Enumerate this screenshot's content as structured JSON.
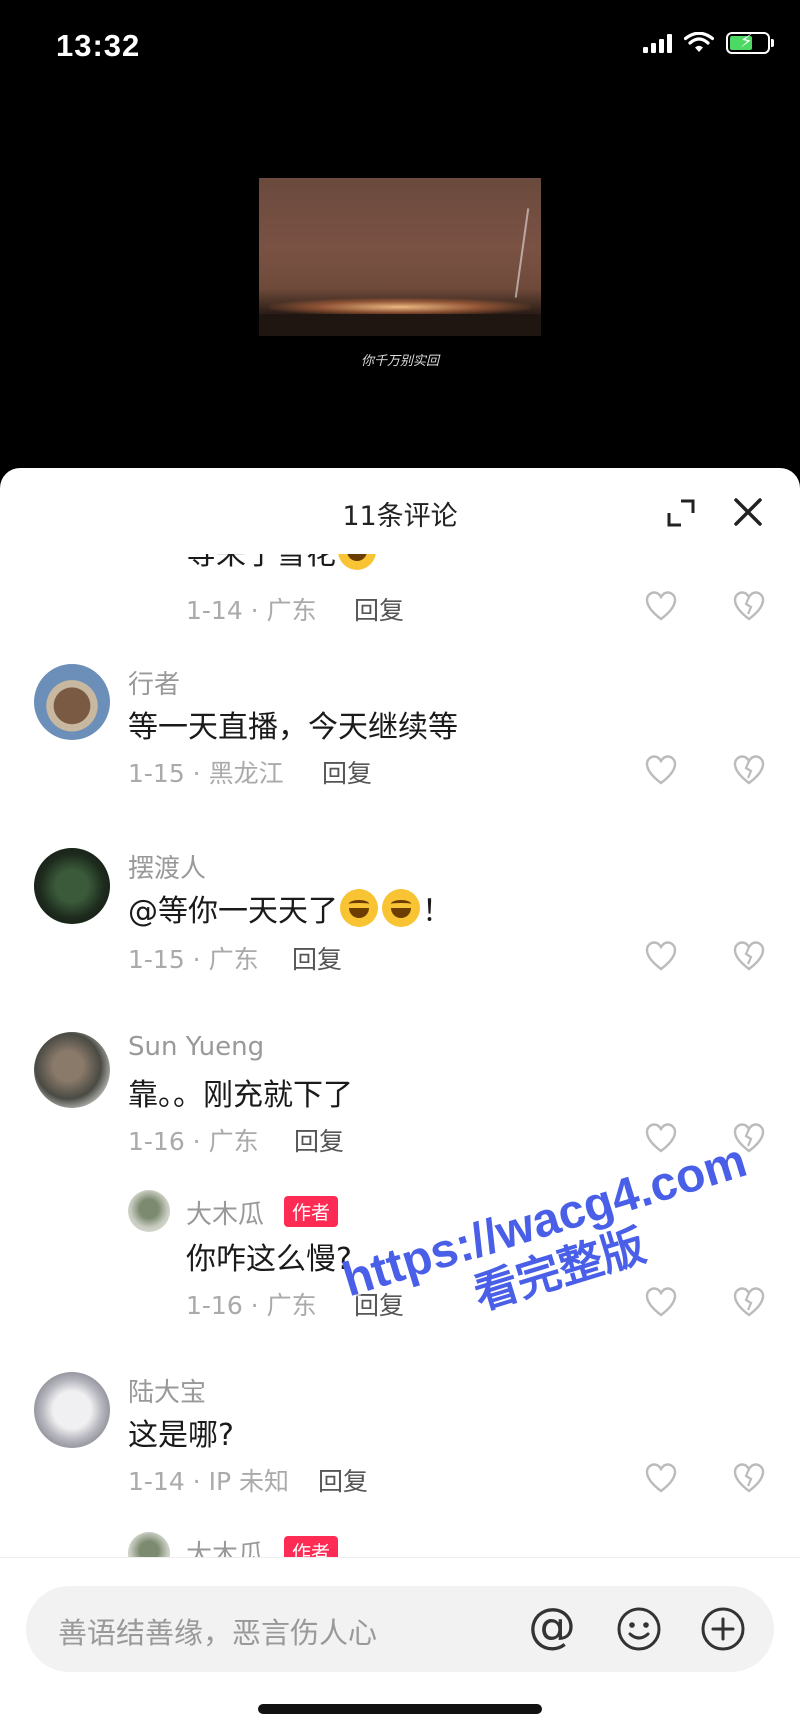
{
  "status_bar": {
    "time": "13:32"
  },
  "video": {
    "caption": "你千万别实回"
  },
  "panel": {
    "title": "11条评论"
  },
  "comments": [
    {
      "text": "等来了雪花",
      "meta": "1-14 · 广东",
      "reply": "回复"
    },
    {
      "name": "行者",
      "text": "等一天直播，今天继续等",
      "meta": "1-15 · 黑龙江",
      "reply": "回复"
    },
    {
      "name": "摆渡人",
      "text": "@等你一天天了",
      "text_suffix": "！",
      "meta": "1-15 · 广东",
      "reply": "回复"
    },
    {
      "name": "Sun Yueng",
      "text": "靠。。刚充就下了",
      "meta": "1-16 · 广东",
      "reply": "回复"
    },
    {
      "name": "大木瓜",
      "badge": "作者",
      "text": "你咋这么慢?",
      "meta": "1-16 · 广东",
      "reply": "回复"
    },
    {
      "name": "陆大宝",
      "text": "这是哪?",
      "meta": "1-14 · IP 未知",
      "reply": "回复"
    },
    {
      "name": "大木瓜",
      "badge": "作者"
    }
  ],
  "input": {
    "placeholder": "善语结善缘，恶言伤人心",
    "at_symbol": "@"
  },
  "watermark": {
    "url": "https://wacg4.com",
    "tag": "看完整版"
  },
  "colors": {
    "author_badge": "#fe2c55",
    "watermark": "#4a5fe8",
    "panel_bg": "#ffffff"
  }
}
